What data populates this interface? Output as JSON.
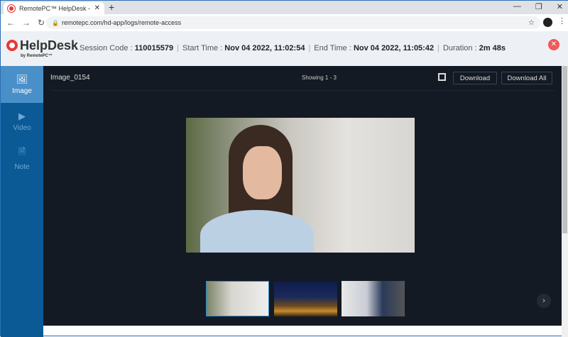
{
  "browser": {
    "tab_title": "RemotePC™ HelpDesk - Remote",
    "tab_close": "✕",
    "new_tab": "+",
    "url": "remotepc.com/hd-app/logs/remote-access",
    "minimize": "—",
    "restore": "❐",
    "close": "✕",
    "back": "←",
    "forward": "→",
    "reload": "↻",
    "lock": "🔒",
    "star": "☆",
    "menu": "⋮"
  },
  "header": {
    "logo_name": "HelpDesk",
    "logo_by": "by RemotePC™",
    "session_label": "Session Code :",
    "session_value": "110015579",
    "start_label": "Start Time :",
    "start_value": "Nov 04 2022, 11:02:54",
    "end_label": "End Time :",
    "end_value": "Nov 04 2022, 11:05:42",
    "duration_label": "Duration :",
    "duration_value": "2m 48s",
    "close": "✕"
  },
  "sidebar": {
    "items": [
      {
        "label": "Image",
        "icon": "🖼",
        "active": true
      },
      {
        "label": "Video",
        "icon": "▶"
      },
      {
        "label": "Note",
        "icon": "🗎"
      }
    ]
  },
  "viewer": {
    "title": "Image_0154",
    "showing": "Showing 1 - 3",
    "download": "Download",
    "download_all": "Download All",
    "next": "›",
    "thumbnail_count": 3,
    "selected_thumbnail": 1
  },
  "colors": {
    "sidebar": "#0b5a96",
    "sidebar_active": "#4a90c8",
    "viewer_bg": "#131a24",
    "close": "#ef5a5a"
  }
}
